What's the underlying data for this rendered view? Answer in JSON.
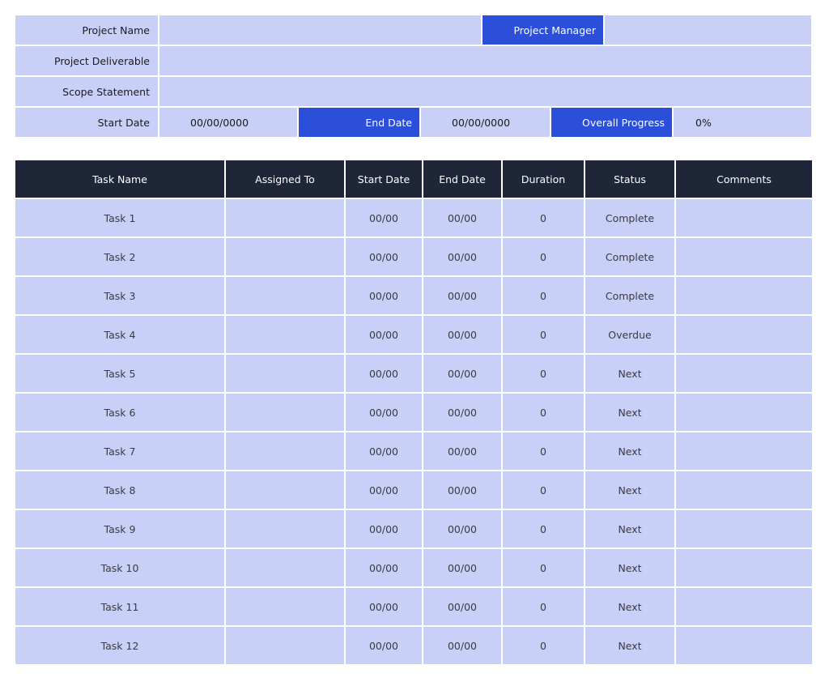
{
  "project_info": {
    "project_name_label": "Project Name",
    "project_name_value": "",
    "project_manager_label": "Project Manager",
    "project_manager_value": "",
    "deliverable_label": "Project Deliverable",
    "deliverable_value": "",
    "scope_label": "Scope Statement",
    "scope_value": "",
    "start_date_label": "Start Date",
    "start_date_value": "00/00/0000",
    "end_date_label": "End Date",
    "end_date_value": "00/00/0000",
    "progress_label": "Overall Progress",
    "progress_value": "0%"
  },
  "tasks": {
    "headers": [
      "Task Name",
      "Assigned To",
      "Start Date",
      "End Date",
      "Duration",
      "Status",
      "Comments"
    ],
    "rows": [
      {
        "name": "Task 1",
        "assigned": "",
        "start": "00/00",
        "end": "00/00",
        "duration": "0",
        "status": "Complete",
        "comments": ""
      },
      {
        "name": "Task 2",
        "assigned": "",
        "start": "00/00",
        "end": "00/00",
        "duration": "0",
        "status": "Complete",
        "comments": ""
      },
      {
        "name": "Task 3",
        "assigned": "",
        "start": "00/00",
        "end": "00/00",
        "duration": "0",
        "status": "Complete",
        "comments": ""
      },
      {
        "name": "Task 4",
        "assigned": "",
        "start": "00/00",
        "end": "00/00",
        "duration": "0",
        "status": "Overdue",
        "comments": ""
      },
      {
        "name": "Task 5",
        "assigned": "",
        "start": "00/00",
        "end": "00/00",
        "duration": "0",
        "status": "Next",
        "comments": ""
      },
      {
        "name": "Task 6",
        "assigned": "",
        "start": "00/00",
        "end": "00/00",
        "duration": "0",
        "status": "Next",
        "comments": ""
      },
      {
        "name": "Task 7",
        "assigned": "",
        "start": "00/00",
        "end": "00/00",
        "duration": "0",
        "status": "Next",
        "comments": ""
      },
      {
        "name": "Task 8",
        "assigned": "",
        "start": "00/00",
        "end": "00/00",
        "duration": "0",
        "status": "Next",
        "comments": ""
      },
      {
        "name": "Task 9",
        "assigned": "",
        "start": "00/00",
        "end": "00/00",
        "duration": "0",
        "status": "Next",
        "comments": ""
      },
      {
        "name": "Task 10",
        "assigned": "",
        "start": "00/00",
        "end": "00/00",
        "duration": "0",
        "status": "Next",
        "comments": ""
      },
      {
        "name": "Task 11",
        "assigned": "",
        "start": "00/00",
        "end": "00/00",
        "duration": "0",
        "status": "Next",
        "comments": ""
      },
      {
        "name": "Task 12",
        "assigned": "",
        "start": "00/00",
        "end": "00/00",
        "duration": "0",
        "status": "Next",
        "comments": ""
      }
    ]
  },
  "colors": {
    "cell_fill": "#c9d0f8",
    "accent_blue": "#2b4fd8",
    "header_dark": "#1e2638"
  }
}
